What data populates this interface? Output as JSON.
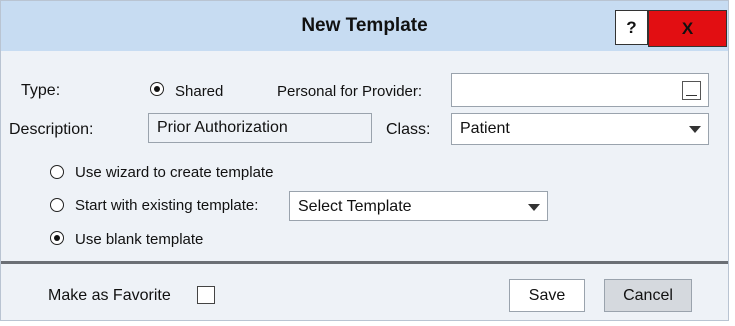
{
  "dialog": {
    "title": "New Template",
    "help_label": "?",
    "close_label": "X"
  },
  "type_row": {
    "label": "Type:",
    "shared_label": "Shared",
    "shared_selected": true,
    "personal_label": "Personal for Provider:",
    "personal_value": ""
  },
  "description_row": {
    "label": "Description:",
    "value": "Prior Authorization",
    "class_label": "Class:",
    "class_value": "Patient"
  },
  "options": {
    "wizard_label": "Use wizard to create template",
    "existing_label": "Start with existing template:",
    "existing_select_value": "Select Template",
    "blank_label": "Use blank template",
    "selected": "blank"
  },
  "footer": {
    "favorite_label": "Make as Favorite",
    "favorite_checked": false,
    "save_label": "Save",
    "cancel_label": "Cancel"
  },
  "colors": {
    "titlebar": "#c7dcf2",
    "close_button": "#e20e12",
    "body": "#eef2f7"
  }
}
